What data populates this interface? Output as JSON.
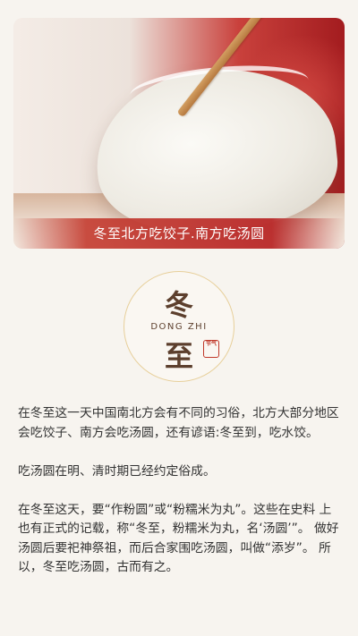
{
  "hero": {
    "image_icon": "dumpling-on-chopsticks-photo",
    "caption": "冬至北方吃饺子.南方吃汤圆"
  },
  "emblem": {
    "char_top": "冬",
    "pinyin": "DONG ZHI",
    "char_bottom": "至",
    "seal_text": "节气"
  },
  "article": {
    "paragraphs": [
      "在冬至这一天中国南北方会有不同的习俗，北方大部分地区 会吃饺子、南方会吃汤圆，还有谚语:冬至到，吃水饺。",
      "吃汤圆在明、清时期已经约定俗成。",
      "在冬至这天，要“作粉圆”或“粉糯米为丸”。这些在史料 上也有正式的记载，称“冬至，粉糯米为丸，名‘汤圆’”。 做好汤圆后要祀神祭祖，而后合家围吃汤圆，叫做“添岁”。 所以，冬至吃汤圆，古而有之。"
    ]
  },
  "colors": {
    "accent_red": "#b9282a",
    "text_brown": "#5c3f2d",
    "background": "#f7f4ef"
  }
}
